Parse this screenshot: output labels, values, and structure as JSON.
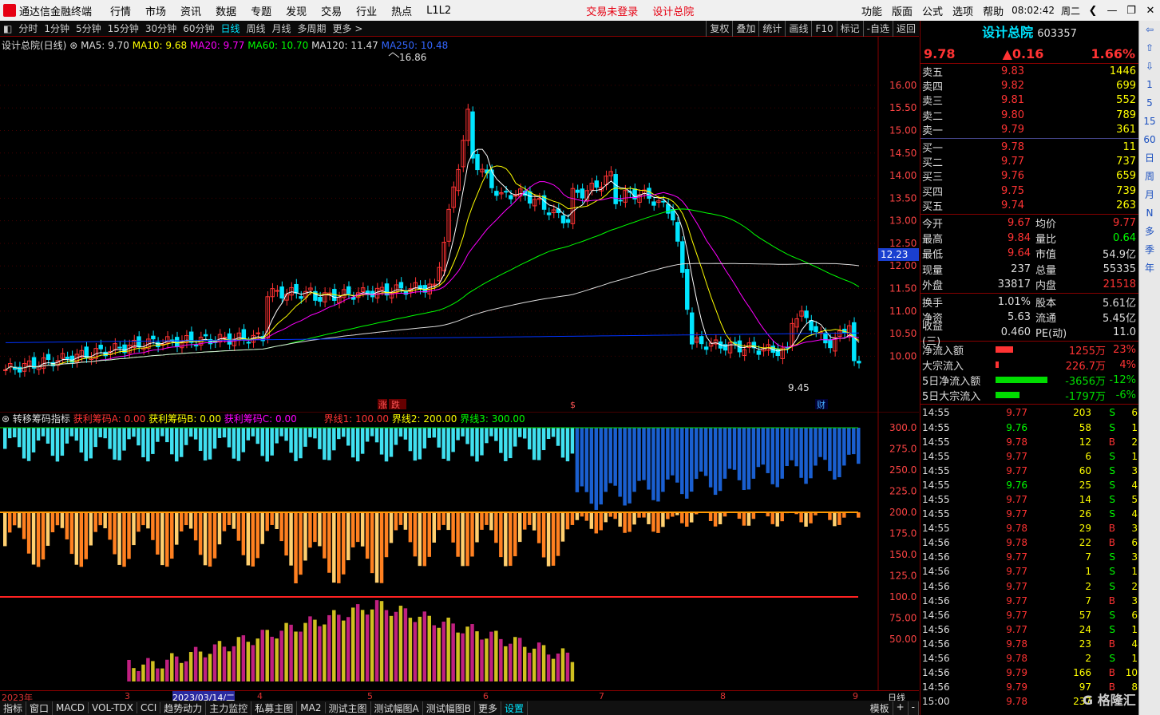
{
  "menubar": {
    "app": "通达信金融终端",
    "items": [
      "行情",
      "市场",
      "资讯",
      "数据",
      "专题",
      "发现",
      "交易",
      "行业",
      "热点",
      "L1L2"
    ],
    "notice1": "交易未登录",
    "notice2": "设计总院",
    "right_items": [
      "功能",
      "版面",
      "公式",
      "选项",
      "帮助"
    ],
    "time": "08:02:42",
    "weekday": "周二"
  },
  "tabs": [
    "分时",
    "1分钟",
    "5分钟",
    "15分钟",
    "30分钟",
    "60分钟",
    "日线",
    "周线",
    "月线",
    "多周期",
    "更多 >"
  ],
  "active_tab": "日线",
  "toolbar_right": [
    "复权",
    "叠加",
    "统计",
    "画线",
    "F10",
    "标记",
    "-自选",
    "返回"
  ],
  "ma_line": {
    "title": "设计总院(日线)",
    "ma5": "MA5: 9.70",
    "ma10": "MA10: 9.68",
    "ma20": "MA20: 9.77",
    "ma60": "MA60: 10.70",
    "ma120": "MA120: 11.47",
    "ma250": "MA250: 10.48"
  },
  "colors": {
    "ma5": "#ffffff",
    "ma10": "#ffff00",
    "ma20": "#ff00ff",
    "ma60": "#00ff00",
    "ma120": "#dddddd",
    "ma250": "#0033ff",
    "up": "#ff3333",
    "down": "#00e5ff"
  },
  "price_axis": [
    "16.00",
    "15.50",
    "15.00",
    "14.50",
    "14.00",
    "13.50",
    "13.00",
    "12.50",
    "12.00",
    "11.50",
    "11.00",
    "10.50",
    "10.00"
  ],
  "price_marker": "12.23",
  "high_label": "16.86",
  "low_label": "9.45",
  "event_marks": [
    "涨",
    "跌",
    "$",
    "财"
  ],
  "indicator": {
    "name": "转移筹码指标",
    "a": "获利筹码A: 0.00",
    "b": "获利筹码B: 0.00",
    "c": "获利筹码C: 0.00",
    "l1": "界线1: 100.00",
    "l2": "界线2: 200.00",
    "l3": "界线3: 300.00",
    "axis": [
      "300.0",
      "275.0",
      "250.0",
      "225.0",
      "200.0",
      "175.0",
      "150.0",
      "125.0",
      "100.0",
      "75.00",
      "50.00"
    ]
  },
  "date_axis": [
    "2023年",
    "3",
    "2023/03/14/二",
    "4",
    "5",
    "6",
    "7",
    "8",
    "9",
    "日线"
  ],
  "bottom_tabs": [
    "指标",
    "窗口",
    "MACD",
    "VOL-TDX",
    "CCI",
    "趋势动力",
    "主力监控",
    "私募主图",
    "MA2",
    "测试主图",
    "测试幅图A",
    "测试幅图B",
    "更多",
    "设置"
  ],
  "bottom_right": [
    "模板",
    "+",
    "-"
  ],
  "stock": {
    "name": "设计总院",
    "code": "603357",
    "price": "9.78",
    "change": "▲0.16",
    "pct": "1.66%"
  },
  "orderbook": [
    {
      "l": "卖五",
      "p": "9.83",
      "v": "1446"
    },
    {
      "l": "卖四",
      "p": "9.82",
      "v": "699"
    },
    {
      "l": "卖三",
      "p": "9.81",
      "v": "552"
    },
    {
      "l": "卖二",
      "p": "9.80",
      "v": "789"
    },
    {
      "l": "卖一",
      "p": "9.79",
      "v": "361"
    },
    {
      "l": "买一",
      "p": "9.78",
      "v": "11"
    },
    {
      "l": "买二",
      "p": "9.77",
      "v": "737"
    },
    {
      "l": "买三",
      "p": "9.76",
      "v": "659"
    },
    {
      "l": "买四",
      "p": "9.75",
      "v": "739"
    },
    {
      "l": "买五",
      "p": "9.74",
      "v": "263"
    }
  ],
  "stats1": [
    {
      "a": "今开",
      "av": "9.67",
      "b": "均价",
      "bv": "9.77"
    },
    {
      "a": "最高",
      "av": "9.84",
      "b": "量比",
      "bv": "0.64"
    },
    {
      "a": "最低",
      "av": "9.64",
      "b": "市值",
      "bv": "54.9亿"
    },
    {
      "a": "现量",
      "av": "237",
      "b": "总量",
      "bv": "55335"
    },
    {
      "a": "外盘",
      "av": "33817",
      "b": "内盘",
      "bv": "21518"
    }
  ],
  "stats2": [
    {
      "a": "换手",
      "av": "1.01%",
      "b": "股本",
      "bv": "5.61亿"
    },
    {
      "a": "净资",
      "av": "5.63",
      "b": "流通",
      "bv": "5.45亿"
    },
    {
      "a": "收益(三)",
      "av": "0.460",
      "b": "PE(动)",
      "bv": "11.0"
    }
  ],
  "flows": [
    {
      "l": "净流入额",
      "v": "1255万",
      "pc": "23%",
      "bar": 0.3,
      "c": "#ff3333"
    },
    {
      "l": "大宗流入",
      "v": "226.7万",
      "pc": "4%",
      "bar": 0.06,
      "c": "#ff3333"
    },
    {
      "l": "5日净流入额",
      "v": "-3656万",
      "pc": "-12%",
      "bar": 0.9,
      "c": "#00dd00"
    },
    {
      "l": "5日大宗流入",
      "v": "-1797万",
      "pc": "-6%",
      "bar": 0.42,
      "c": "#00dd00"
    }
  ],
  "ticks": [
    [
      "14:55",
      "9.77",
      "203",
      "S",
      "6"
    ],
    [
      "14:55",
      "9.76",
      "58",
      "S",
      "1"
    ],
    [
      "14:55",
      "9.78",
      "12",
      "B",
      "2"
    ],
    [
      "14:55",
      "9.77",
      "6",
      "S",
      "1"
    ],
    [
      "14:55",
      "9.77",
      "60",
      "S",
      "3"
    ],
    [
      "14:55",
      "9.76",
      "25",
      "S",
      "4"
    ],
    [
      "14:55",
      "9.77",
      "14",
      "S",
      "5"
    ],
    [
      "14:55",
      "9.77",
      "26",
      "S",
      "4"
    ],
    [
      "14:55",
      "9.78",
      "29",
      "B",
      "3"
    ],
    [
      "14:56",
      "9.78",
      "22",
      "B",
      "6"
    ],
    [
      "14:56",
      "9.77",
      "7",
      "S",
      "3"
    ],
    [
      "14:56",
      "9.77",
      "1",
      "S",
      "1"
    ],
    [
      "14:56",
      "9.77",
      "2",
      "S",
      "2"
    ],
    [
      "14:56",
      "9.77",
      "7",
      "B",
      "3"
    ],
    [
      "14:56",
      "9.77",
      "57",
      "S",
      "6"
    ],
    [
      "14:56",
      "9.77",
      "24",
      "S",
      "1"
    ],
    [
      "14:56",
      "9.78",
      "23",
      "B",
      "4"
    ],
    [
      "14:56",
      "9.78",
      "2",
      "S",
      "1"
    ],
    [
      "14:56",
      "9.79",
      "166",
      "B",
      "10"
    ],
    [
      "14:56",
      "9.79",
      "97",
      "B",
      "8"
    ],
    [
      "15:00",
      "9.78",
      "237",
      "",
      ""
    ]
  ],
  "sidebar": [
    "⇦",
    "⇧",
    "⇩",
    "1",
    "5",
    "15",
    "60",
    "日",
    "周",
    "月",
    "N",
    "多",
    "季",
    "年"
  ]
}
